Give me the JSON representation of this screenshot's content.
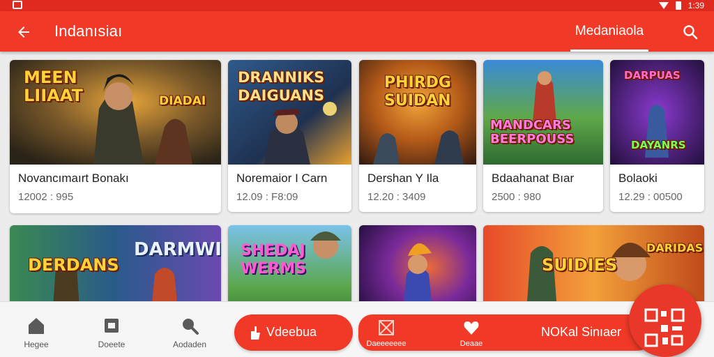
{
  "app": {
    "title": "Indanısiaı",
    "active_tab": "Medaniaola",
    "status_time": "1:39"
  },
  "colors": {
    "primary": "#f03a27",
    "status_bar": "#e02a1f",
    "background": "#ececec",
    "card_bg": "#ffffff",
    "title_text": "#222222",
    "meta_text": "#666666"
  },
  "thumb_labels": {
    "c1": [
      "MEEN",
      "LIIAAT"
    ],
    "c1b": [
      "DIADAI"
    ],
    "c2": [
      "DRANNIKS",
      "DAIGUANS"
    ],
    "c3": [
      "PHIRDG",
      "SUIDAN"
    ],
    "c4": [
      "MANDCARS",
      "BEERPOUSS"
    ],
    "c5": [
      "DARPUAS",
      "DAYANRS"
    ],
    "r2c1": [
      "DERDANS"
    ],
    "r2c1b": [
      "DARMWINS"
    ],
    "r2c2": [
      "SHEDAJ",
      "WERMS"
    ],
    "r2c4": [
      "SUIDIES"
    ],
    "r2c4b": [
      "DARIDAS"
    ]
  },
  "games": [
    {
      "title": "Novancımaırt Bonakı",
      "meta": "12002 : 995"
    },
    {
      "title": "Noremaior I Carn",
      "meta": "12.09 : F8:09"
    },
    {
      "title": "Dershan Y Ila",
      "meta": "12.20 : 3409"
    },
    {
      "title": "Bdaahanat Bıar",
      "meta": "2500 : 980"
    },
    {
      "title": "Bolaoki",
      "meta": "12.29 : 00500"
    }
  ],
  "bottom_nav": {
    "home": "Hegee",
    "docs": "Doeete",
    "search": "Aodaden",
    "pill1": "Vdeebua",
    "sub1": "Daeeeeeee",
    "sub2": "Deaae",
    "pill2": "NOKal Sinıaer"
  },
  "icons": {
    "back": "arrow-left-icon",
    "search": "search-icon",
    "home": "home-icon",
    "docs": "document-icon",
    "nav_search": "magnifier-icon",
    "pill1": "hand-icon",
    "sub1": "crossed-box-icon",
    "sub2": "heart-icon",
    "fab": "qr-code-icon"
  }
}
